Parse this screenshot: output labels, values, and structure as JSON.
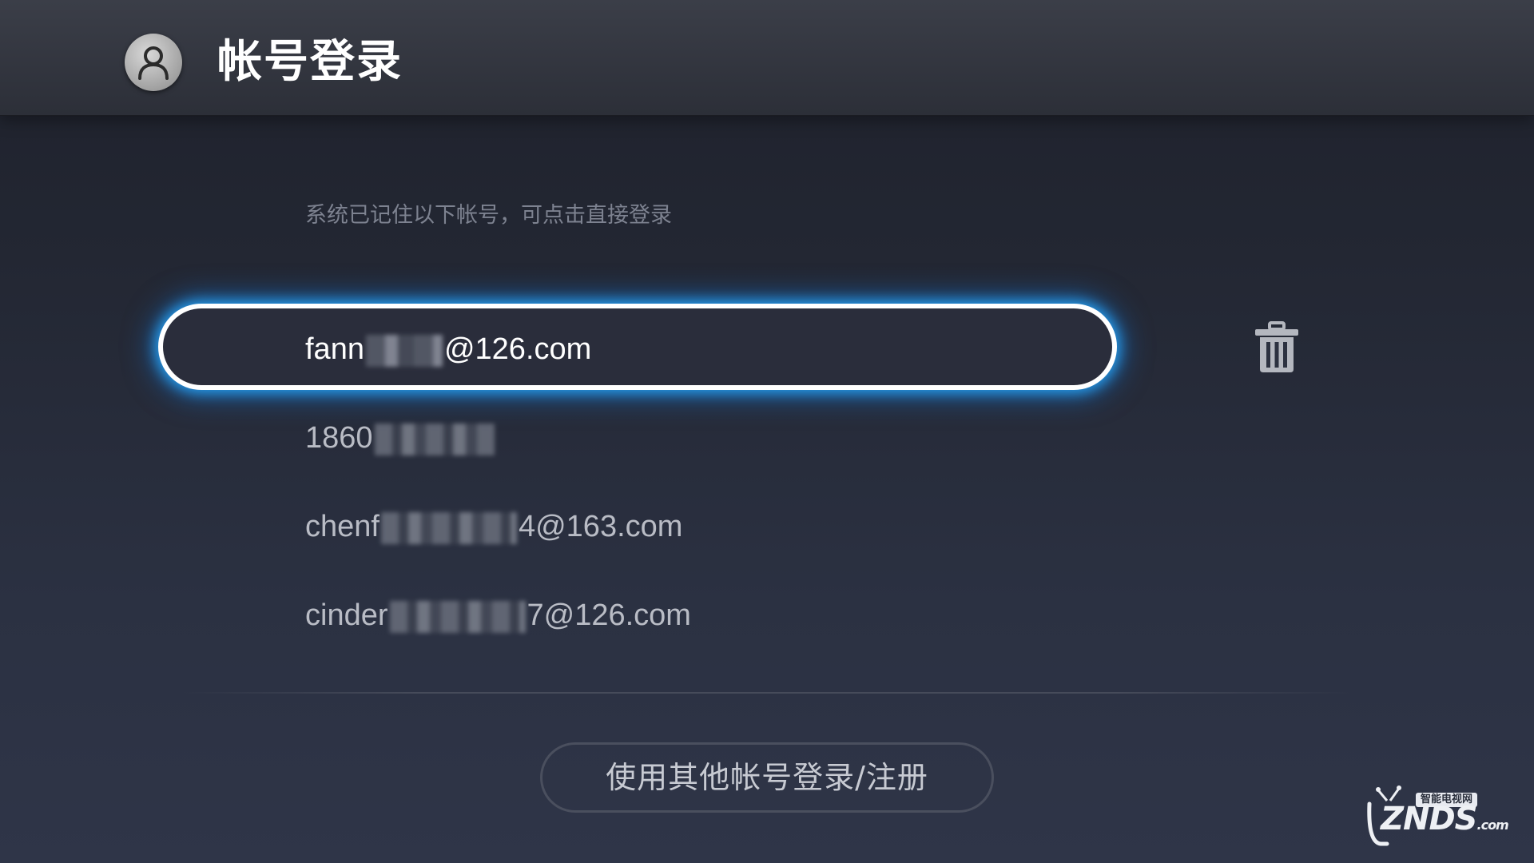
{
  "header": {
    "title": "帐号登录",
    "avatar_icon": "user-icon"
  },
  "hint": "系统已记住以下帐号，可点击直接登录",
  "accounts": [
    {
      "prefix": "fann",
      "suffix": "@126.com",
      "selected": true
    },
    {
      "prefix": "1860",
      "suffix": "",
      "selected": false
    },
    {
      "prefix": "chenf",
      "suffix": "4@163.com",
      "selected": false
    },
    {
      "prefix": "cinder",
      "suffix": "7@126.com",
      "selected": false
    }
  ],
  "delete_icon": "trash-icon",
  "other_account_button": "使用其他帐号登录/注册",
  "watermark": {
    "brand": "ZNDS",
    "domain": ".com",
    "tagline": "智能电视网"
  },
  "colors": {
    "focus_glow": "#28aaff",
    "background": "#2b3142",
    "text_primary": "#ffffff"
  }
}
